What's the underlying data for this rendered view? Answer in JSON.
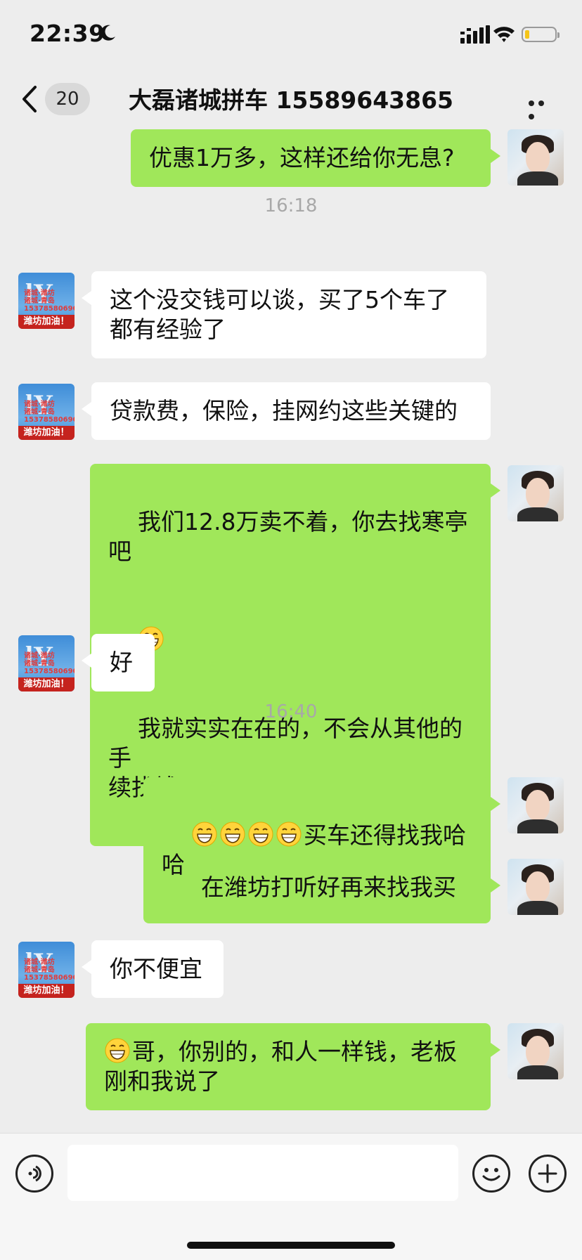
{
  "status_bar": {
    "time": "22:39"
  },
  "nav": {
    "unread_count": "20",
    "title": "大磊诸城拼车 15589643865"
  },
  "avatars": {
    "shop_banner": "潍坊加油！",
    "shop_lines": [
      "诸城·潍坊",
      "诸城·青岛",
      "15378580690"
    ]
  },
  "chat": {
    "messages": [
      {
        "side": "mine",
        "text": "优惠1万多，这样还给你无息?"
      },
      {
        "type": "timestamp",
        "text": "16:18"
      },
      {
        "side": "theirs",
        "text": "这个没交钱可以谈，买了5个车了\n都有经验了"
      },
      {
        "side": "theirs",
        "text": "贷款费，保险，挂网约这些关键的"
      },
      {
        "side": "mine",
        "line1": "我们12.8万卖不着，你去找寒亭吧",
        "line2": "我就实实在在的，不会从其他的手\n续找钱"
      },
      {
        "side": "theirs",
        "text": "好"
      },
      {
        "type": "timestamp",
        "text": "16:40"
      },
      {
        "side": "mine",
        "text": "买车还得找我哈哈"
      },
      {
        "side": "mine",
        "text": "在潍坊打听好再来找我买"
      },
      {
        "side": "theirs",
        "text": "你不便宜"
      },
      {
        "side": "mine",
        "text": "哥，你别的，和人一样钱，老板\n刚和我说了"
      }
    ]
  },
  "icons": {
    "grin_emoji": "grinning-face-icon",
    "voice": "voice-icon",
    "emoji": "smile-icon",
    "plus": "plus-icon"
  }
}
